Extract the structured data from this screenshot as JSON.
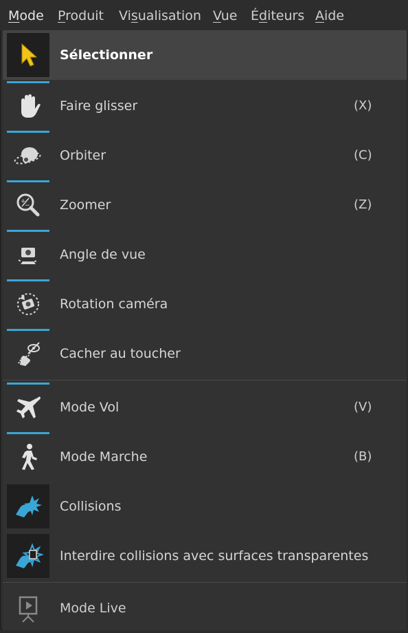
{
  "menubar": {
    "items": [
      {
        "pre": "",
        "u": "M",
        "post": "ode"
      },
      {
        "pre": "",
        "u": "P",
        "post": "roduit"
      },
      {
        "pre": "Vi",
        "u": "s",
        "post": "ualisation"
      },
      {
        "pre": "",
        "u": "V",
        "post": "ue"
      },
      {
        "pre": "É",
        "u": "d",
        "post": "iteurs"
      },
      {
        "pre": "",
        "u": "A",
        "post": "ide"
      }
    ]
  },
  "menu": {
    "items": [
      {
        "label": "Sélectionner",
        "shortcut": "",
        "icon": "cursor-arrow-icon"
      },
      {
        "label": "Faire glisser",
        "shortcut": "(X)",
        "icon": "hand-icon"
      },
      {
        "label": "Orbiter",
        "shortcut": "(C)",
        "icon": "orbit-icon"
      },
      {
        "label": "Zoomer",
        "shortcut": "(Z)",
        "icon": "zoom-icon"
      },
      {
        "label": "Angle de vue",
        "shortcut": "",
        "icon": "camera-angle-icon"
      },
      {
        "label": "Rotation caméra",
        "shortcut": "",
        "icon": "camera-rotate-icon"
      },
      {
        "label": "Cacher au toucher",
        "shortcut": "",
        "icon": "hide-touch-icon"
      },
      {
        "label": "Mode Vol",
        "shortcut": "(V)",
        "icon": "airplane-icon"
      },
      {
        "label": "Mode Marche",
        "shortcut": "(B)",
        "icon": "walking-person-icon"
      },
      {
        "label": "Collisions",
        "shortcut": "",
        "icon": "collision-icon"
      },
      {
        "label": "Interdire collisions avec surfaces transparentes",
        "shortcut": "",
        "icon": "transparent-collision-icon"
      },
      {
        "label": "Mode Live",
        "shortcut": "",
        "icon": "presentation-play-icon"
      }
    ]
  },
  "colors": {
    "accent": "#3aa6d6",
    "selected_icon": "#f0c419",
    "collision_icon": "#3aa6d6"
  }
}
